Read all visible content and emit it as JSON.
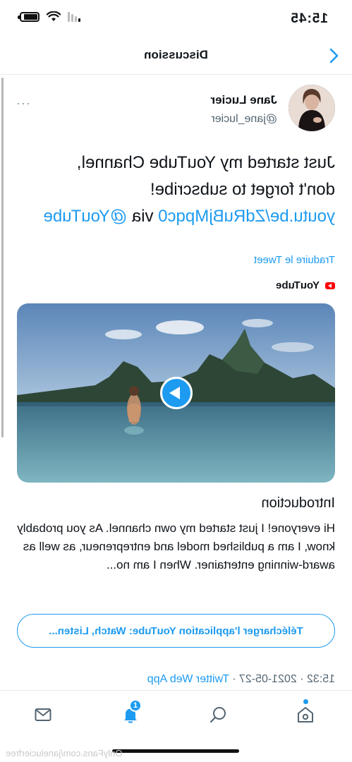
{
  "status_bar": {
    "time": "15:45"
  },
  "nav": {
    "title": "Discussion"
  },
  "tweet": {
    "author_name": "Jane Lucier",
    "author_handle": "@jane_lucier",
    "more_label": "···",
    "text_line1": "Just started my YouTube Channel,",
    "text_line2": "don't forget to subscribe!",
    "link": "youtu.be/ZdRuBjMpqc0",
    "via": " via ",
    "via_account": "@YouTube",
    "translate": "Traduire le Tweet",
    "timestamp": "15:32 · 2021-05-27 · ",
    "source_app": "Twitter Web App"
  },
  "card": {
    "source": "YouTube",
    "title": "Introduction",
    "description": "Hi everyone! I just started my own channel. As you probably know, I am a published model and entrepreneur, as well as award-winning entertainer. When I am no...",
    "cta": "Télécharger l'application YouTube: Watch, Listen..."
  },
  "tab_bar": {
    "notification_count": "1"
  },
  "watermark": "OnlyFans.com/janelucierfree",
  "colors": {
    "accent": "#1d9bf0",
    "text": "#0f1419",
    "secondary": "#536471"
  },
  "icons": [
    "chevron-left-icon",
    "more-icon",
    "youtube-icon",
    "play-icon",
    "home-icon",
    "search-icon",
    "bell-icon",
    "mail-icon",
    "wifi-icon",
    "battery-icon",
    "signal-icon"
  ]
}
